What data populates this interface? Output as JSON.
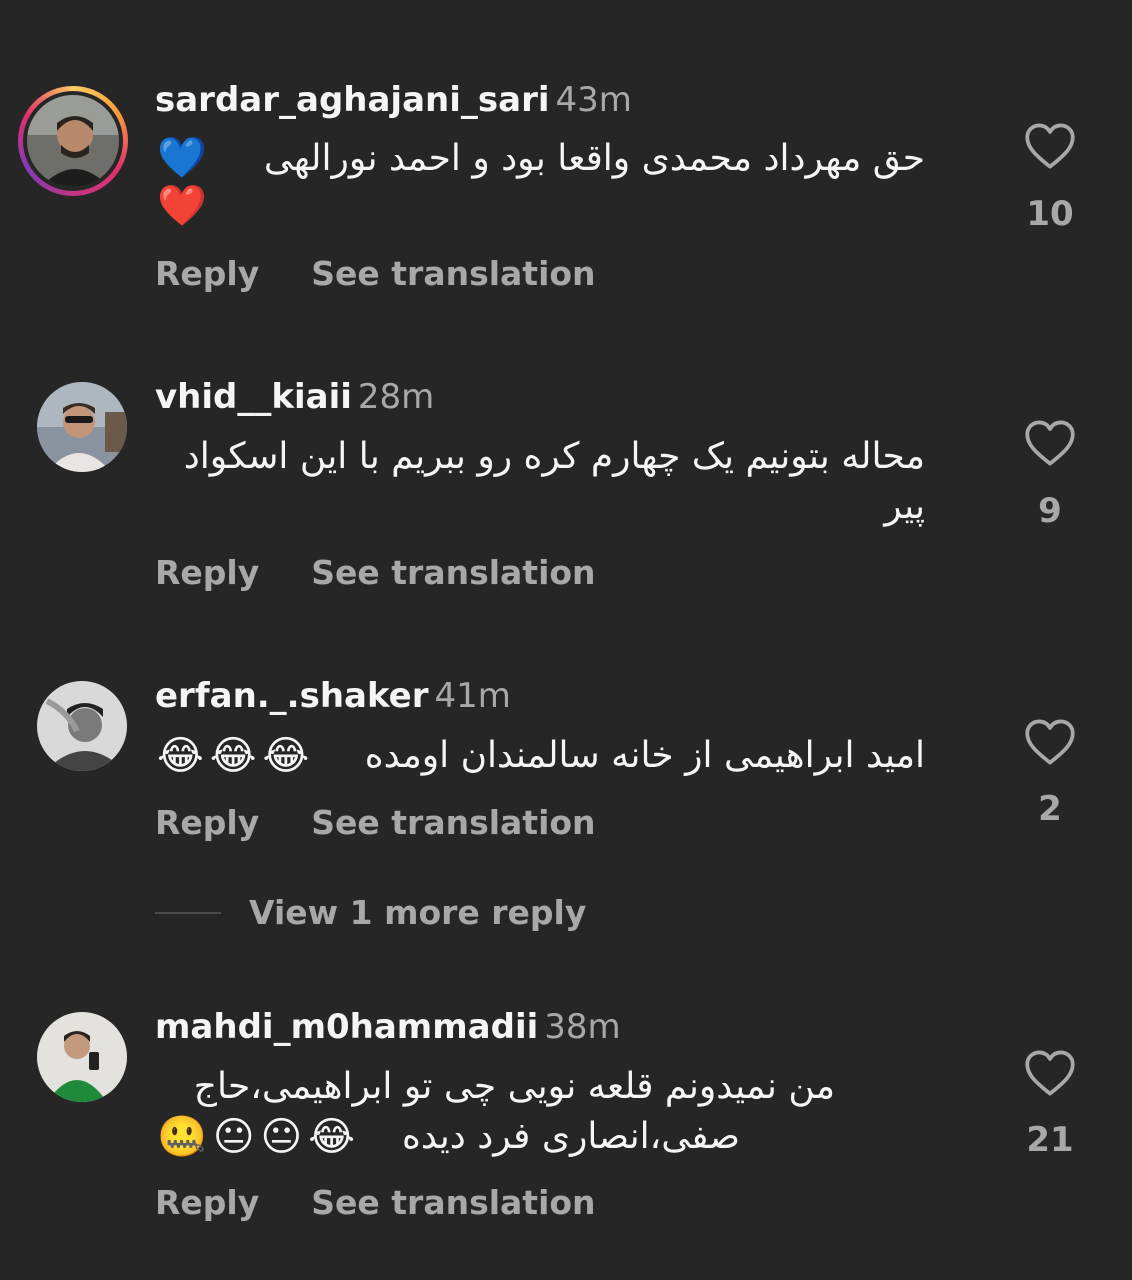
{
  "comments": [
    {
      "username": "sardar_aghajani_sari",
      "time": "43m",
      "text": "حق مهرداد محمدی واقعا بود و احمد نورالهی",
      "emojis": [
        "💙",
        "❤️"
      ],
      "like_count": "10",
      "reply_label": "Reply",
      "translate_label": "See translation"
    },
    {
      "username": "vhid__kiaii",
      "time": "28m",
      "text": "محاله بتونیم یک چهارم کره رو ببریم با این اسکواد پیر",
      "like_count": "9",
      "reply_label": "Reply",
      "translate_label": "See translation"
    },
    {
      "username": "erfan._.shaker",
      "time": "41m",
      "text": "امید ابراهیمی از خانه سالمندان اومده",
      "emojis": [
        "😂",
        "😂",
        "😂"
      ],
      "like_count": "2",
      "reply_label": "Reply",
      "translate_label": "See translation",
      "view_more_replies": "View 1 more reply"
    },
    {
      "username": "mahdi_m0hammadii",
      "time": "38m",
      "text_line1": "من نمیدونم قلعه نویی چی تو ابراهیمی،حاج",
      "text_line2": "صفی،انصاری فرد دیده",
      "emojis": [
        "😂",
        "😐",
        "😐",
        "🤐"
      ],
      "like_count": "21",
      "reply_label": "Reply",
      "translate_label": "See translation"
    }
  ],
  "icons": {
    "like": "heart-outline-icon"
  },
  "colors": {
    "background": "#262626",
    "primary_text": "#f5f5f5",
    "secondary_text": "#a8a8a8"
  }
}
